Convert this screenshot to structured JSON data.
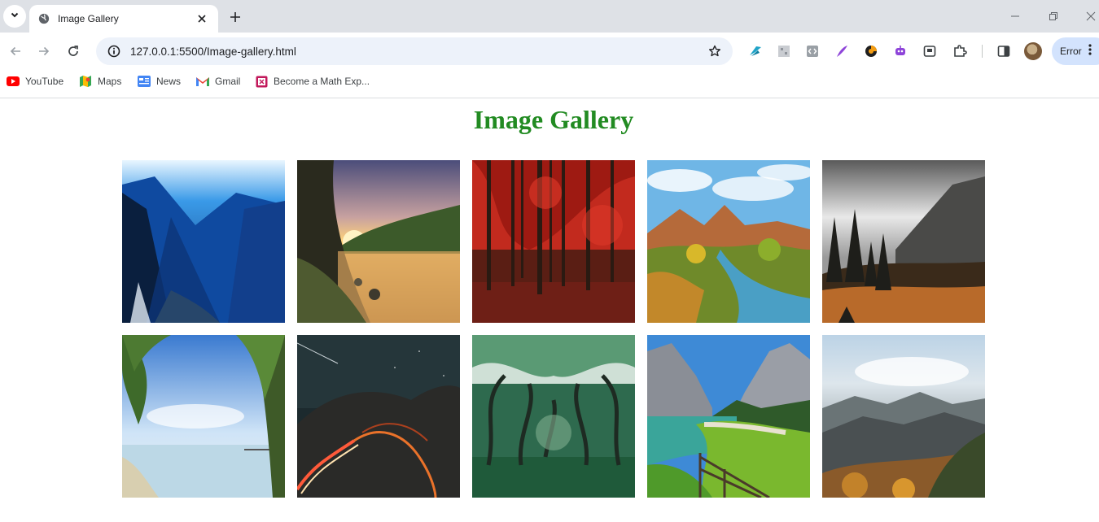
{
  "browser": {
    "tab_title": "Image Gallery",
    "url": "127.0.0.1:5500/Image-gallery.html",
    "profile_button_label": "Error",
    "bookmarks": [
      {
        "label": "YouTube",
        "icon": "youtube-icon"
      },
      {
        "label": "Maps",
        "icon": "maps-icon"
      },
      {
        "label": "News",
        "icon": "news-icon"
      },
      {
        "label": "Gmail",
        "icon": "gmail-icon"
      },
      {
        "label": "Become a Math Exp...",
        "icon": "bookmark-site-icon"
      }
    ]
  },
  "page": {
    "title": "Image Gallery",
    "title_color": "#228b22",
    "images": [
      {
        "subject": "blue mountain valley with waterfall"
      },
      {
        "subject": "sunset over lake with forested hills"
      },
      {
        "subject": "red autumn forest"
      },
      {
        "subject": "mountain river valley under cloudy sky"
      },
      {
        "subject": "dark pine forest below cloudy mountains"
      },
      {
        "subject": "tropical beach framed by palm trees"
      },
      {
        "subject": "night road with light trails under starry sky"
      },
      {
        "subject": "green tree tunnel over grass"
      },
      {
        "subject": "alpine lake with wooden fence and meadow"
      },
      {
        "subject": "misty mountain range with autumn foliage"
      }
    ]
  }
}
